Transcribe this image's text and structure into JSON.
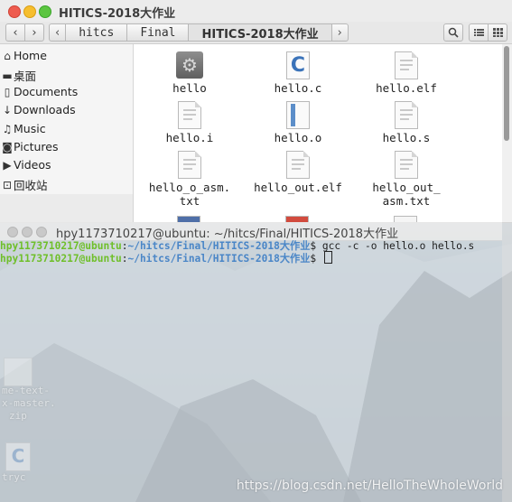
{
  "file_manager": {
    "title": "HITICS-2018大作业",
    "breadcrumbs": [
      "hitcs",
      "Final",
      "HITICS-2018大作业"
    ],
    "sidebar": [
      {
        "label": "Home",
        "icon": "home-icon"
      },
      {
        "label": "桌面",
        "icon": "folder-icon"
      },
      {
        "label": "Documents",
        "icon": "document-icon"
      },
      {
        "label": "Downloads",
        "icon": "download-icon"
      },
      {
        "label": "Music",
        "icon": "music-icon"
      },
      {
        "label": "Pictures",
        "icon": "camera-icon"
      },
      {
        "label": "Videos",
        "icon": "video-icon"
      },
      {
        "label": "回收站",
        "icon": "trash-icon"
      }
    ],
    "files": [
      {
        "name": "hello",
        "icon": "executable-gear-icon"
      },
      {
        "name": "hello.c",
        "icon": "c-source-icon"
      },
      {
        "name": "hello.elf",
        "icon": "text-document-icon"
      },
      {
        "name": "hello.i",
        "icon": "text-document-icon"
      },
      {
        "name": "hello.o",
        "icon": "object-file-icon"
      },
      {
        "name": "hello.s",
        "icon": "text-document-icon"
      },
      {
        "name_line1": "hello_o_asm.",
        "name_line2": "txt",
        "icon": "text-document-icon"
      },
      {
        "name": "hello_out.elf",
        "icon": "text-document-icon"
      },
      {
        "name_line1": "hello_out_",
        "name_line2": "asm.txt",
        "icon": "text-document-icon"
      }
    ]
  },
  "terminal": {
    "title": "hpy1173710217@ubuntu: ~/hitcs/Final/HITICS-2018大作业",
    "lines": [
      {
        "user": "hpy1173710217@ubuntu",
        "sep": ":",
        "path": "~/hitcs/Final/HITICS-2018大作业",
        "prompt": "$ ",
        "command": "gcc -c -o hello.o hello.s"
      },
      {
        "user": "hpy1173710217@ubuntu",
        "sep": ":",
        "path": "~/hitcs/Final/HITICS-2018大作业",
        "prompt": "$ ",
        "command": ""
      }
    ]
  },
  "desktop": {
    "icon1_line1": "me-text-",
    "icon1_line2": "x-master.",
    "icon1_line3": "zip",
    "icon2_label": "tryc"
  },
  "watermark": "https://blog.csdn.net/HelloTheWholeWorld"
}
